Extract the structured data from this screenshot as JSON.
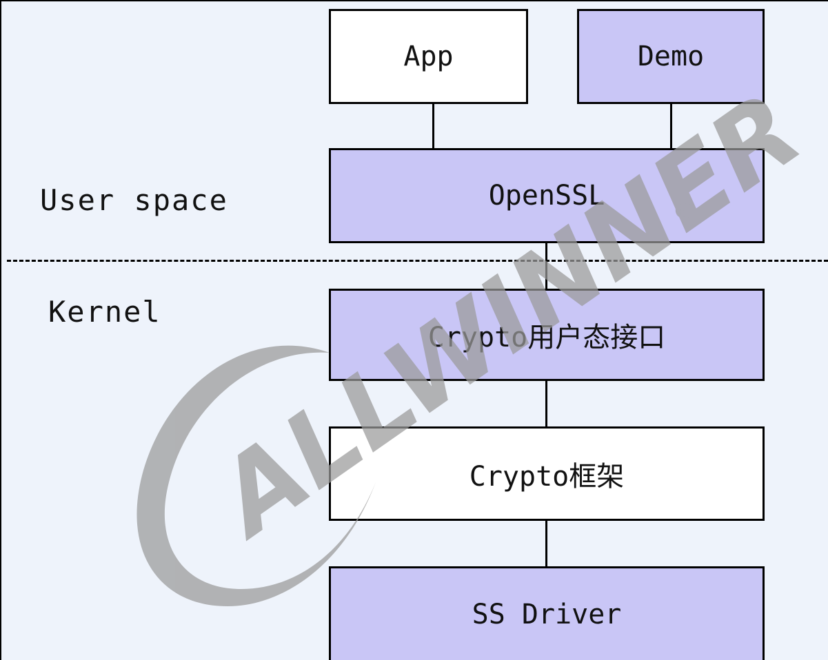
{
  "diagram": {
    "layers": {
      "user_space": "User space",
      "kernel": "Kernel"
    },
    "nodes": {
      "app": "App",
      "demo": "Demo",
      "openssl": "OpenSSL",
      "crypto_user_api": "Crypto用户态接口",
      "crypto_framework": "Crypto框架",
      "ss_driver": "SS Driver"
    },
    "colors": {
      "background": "#eef3fb",
      "highlight_box": "#c9c6f6",
      "plain_box": "#ffffff",
      "watermark": "#9a9a9a"
    }
  },
  "watermark": {
    "brand": "ALLWINNER",
    "registered_mark": "®"
  }
}
